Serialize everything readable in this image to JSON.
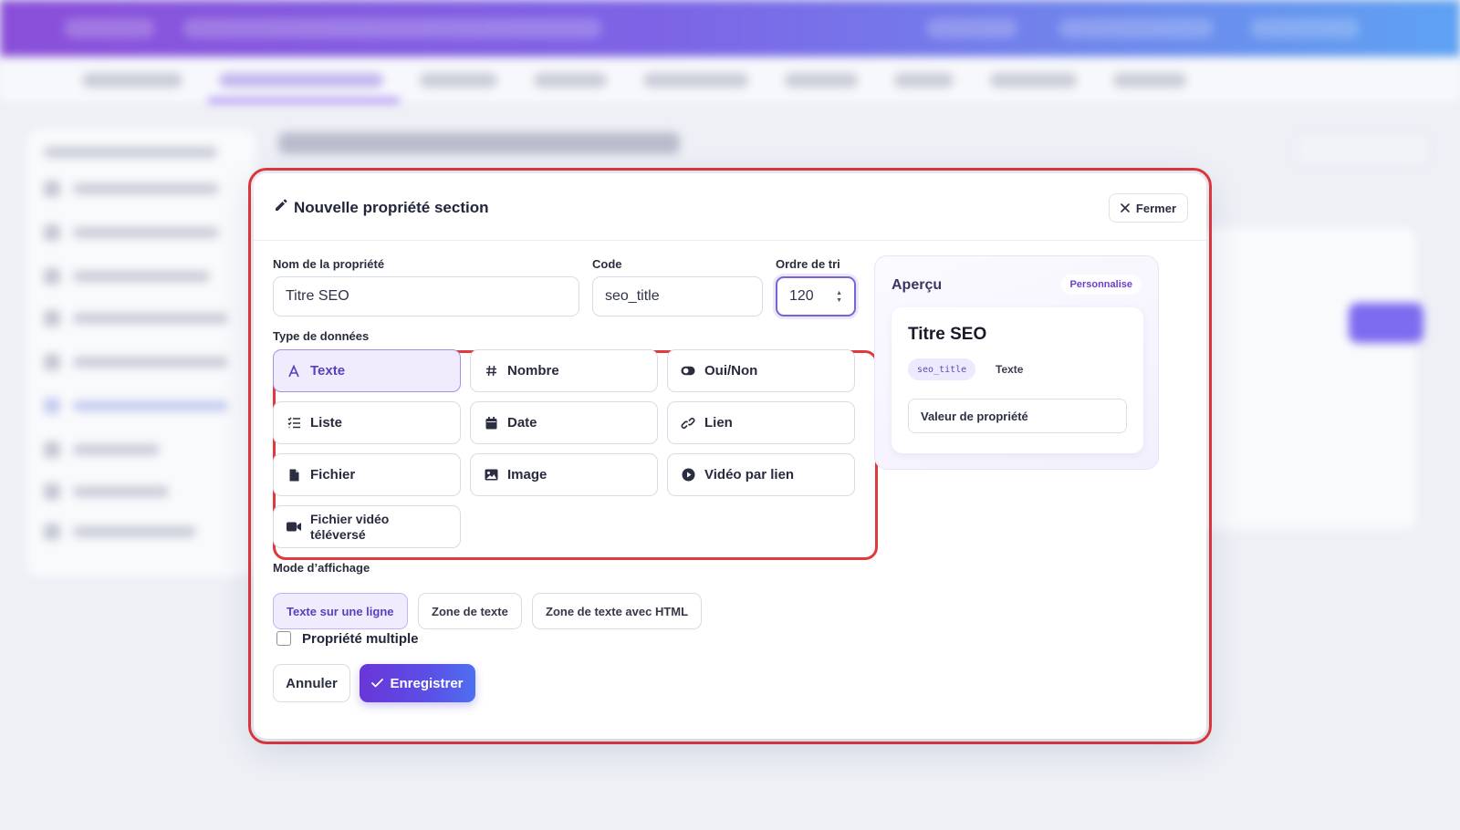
{
  "modal": {
    "title": "Nouvelle propriété section",
    "close_label": "Fermer"
  },
  "form": {
    "name_label": "Nom de la propriété",
    "name_value": "Titre SEO",
    "code_label": "Code",
    "code_value": "seo_title",
    "sort_label": "Ordre de tri",
    "sort_value": "120",
    "data_type_label": "Type de données",
    "data_types": [
      {
        "label": "Texte",
        "icon": "text-icon",
        "active": true
      },
      {
        "label": "Nombre",
        "icon": "hash-icon",
        "active": false
      },
      {
        "label": "Oui/Non",
        "icon": "toggle-icon",
        "active": false
      },
      {
        "label": "Liste",
        "icon": "list-icon",
        "active": false
      },
      {
        "label": "Date",
        "icon": "calendar-icon",
        "active": false
      },
      {
        "label": "Lien",
        "icon": "link-icon",
        "active": false
      },
      {
        "label": "Fichier",
        "icon": "file-icon",
        "active": false
      },
      {
        "label": "Image",
        "icon": "image-icon",
        "active": false
      },
      {
        "label": "Vidéo par lien",
        "icon": "play-circle-icon",
        "active": false
      },
      {
        "label": "Fichier vidéo téléversé",
        "icon": "video-camera-icon",
        "active": false
      }
    ],
    "display_mode_label": "Mode d’affichage",
    "display_modes": [
      {
        "label": "Texte sur une ligne",
        "active": true
      },
      {
        "label": "Zone de texte",
        "active": false
      },
      {
        "label": "Zone de texte avec HTML",
        "active": false
      }
    ],
    "multiple_label": "Propriété multiple",
    "multiple_checked": false,
    "cancel_label": "Annuler",
    "save_label": "Enregistrer"
  },
  "preview": {
    "title": "Aperçu",
    "badge": "Personnalise",
    "card_title": "Titre SEO",
    "code_chip": "seo_title",
    "type_chip": "Texte",
    "value_placeholder": "Valeur de propriété"
  },
  "colors": {
    "accent": "#6a3fd0",
    "highlight_outline": "#e0393e",
    "header_gradient_start": "#8a4fd9",
    "header_gradient_end": "#5ea2f2"
  }
}
